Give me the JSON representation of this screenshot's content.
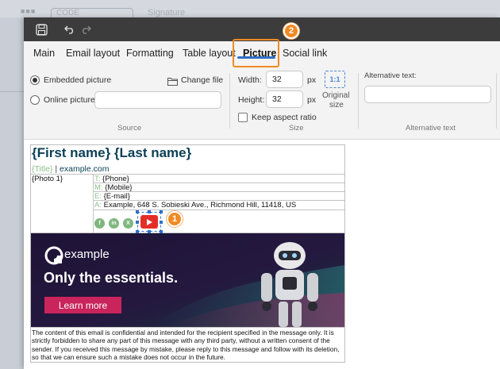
{
  "background": {
    "code_tab": "CODE",
    "window_title": "Signature"
  },
  "titlebar": {
    "icons": [
      "save-icon",
      "undo-icon",
      "redo-icon"
    ]
  },
  "tabs": [
    {
      "label": "Main"
    },
    {
      "label": "Email layout"
    },
    {
      "label": "Formatting"
    },
    {
      "label": "Table layout"
    },
    {
      "label": "Picture",
      "active": true
    },
    {
      "label": "Social link"
    }
  ],
  "callouts": {
    "tab_badge": "2",
    "image_badge": "1"
  },
  "picture": {
    "source_label": "Source",
    "embedded_label": "Embedded picture",
    "online_label": "Online picture:",
    "online_value": "",
    "change_file_label": "Change file",
    "size_label": "Size",
    "width_label": "Width:",
    "width_value": "32",
    "height_label": "Height:",
    "height_value": "32",
    "unit": "px",
    "original_size_icon": "1:1",
    "original_size_label_1": "Original",
    "original_size_label_2": "size",
    "keep_aspect_label": "Keep aspect ratio",
    "keep_aspect_checked": false,
    "alt_label": "Alternative text:",
    "alt_value": "",
    "alt_section_label": "Alternative text"
  },
  "signature": {
    "name": "{First name} {Last name}",
    "title": "{Title}",
    "separator": " | ",
    "website": "example.com",
    "photo": "{Photo 1}",
    "rows": [
      {
        "key": "T:",
        "value": "{Phone}"
      },
      {
        "key": "M:",
        "value": "{Mobile}"
      },
      {
        "key": "E:",
        "value": "{E-mail}"
      },
      {
        "key": "A:",
        "value": "Example, 648 S. Sobieski Ave., Richmond Hill, 11418, US"
      }
    ],
    "social_icons": [
      "facebook-icon",
      "linkedin-icon",
      "x-icon",
      "youtube-icon"
    ],
    "social_glyphs": [
      "f",
      "in",
      "X"
    ],
    "banner": {
      "logo_text": "example",
      "tagline": "Only the essentials.",
      "button": "Learn more",
      "colors": {
        "background": "#1e1436",
        "accent": "#c9245b",
        "teal": "#2a6f73"
      }
    },
    "disclaimer": "The content of this email is confidential and intended for the recipient specified in the message only. It is strictly forbidden to share any part of this message with any third party, without a written consent of the sender. If you received this message by mistake, please reply to this message and follow with its deletion, so that we can ensure such a mistake does not occur in the future."
  },
  "colors": {
    "accent_orange": "#f08a24",
    "selection_blue": "#2f6fc9",
    "name_color": "#0b3f57",
    "label_green": "#8cc08c"
  }
}
